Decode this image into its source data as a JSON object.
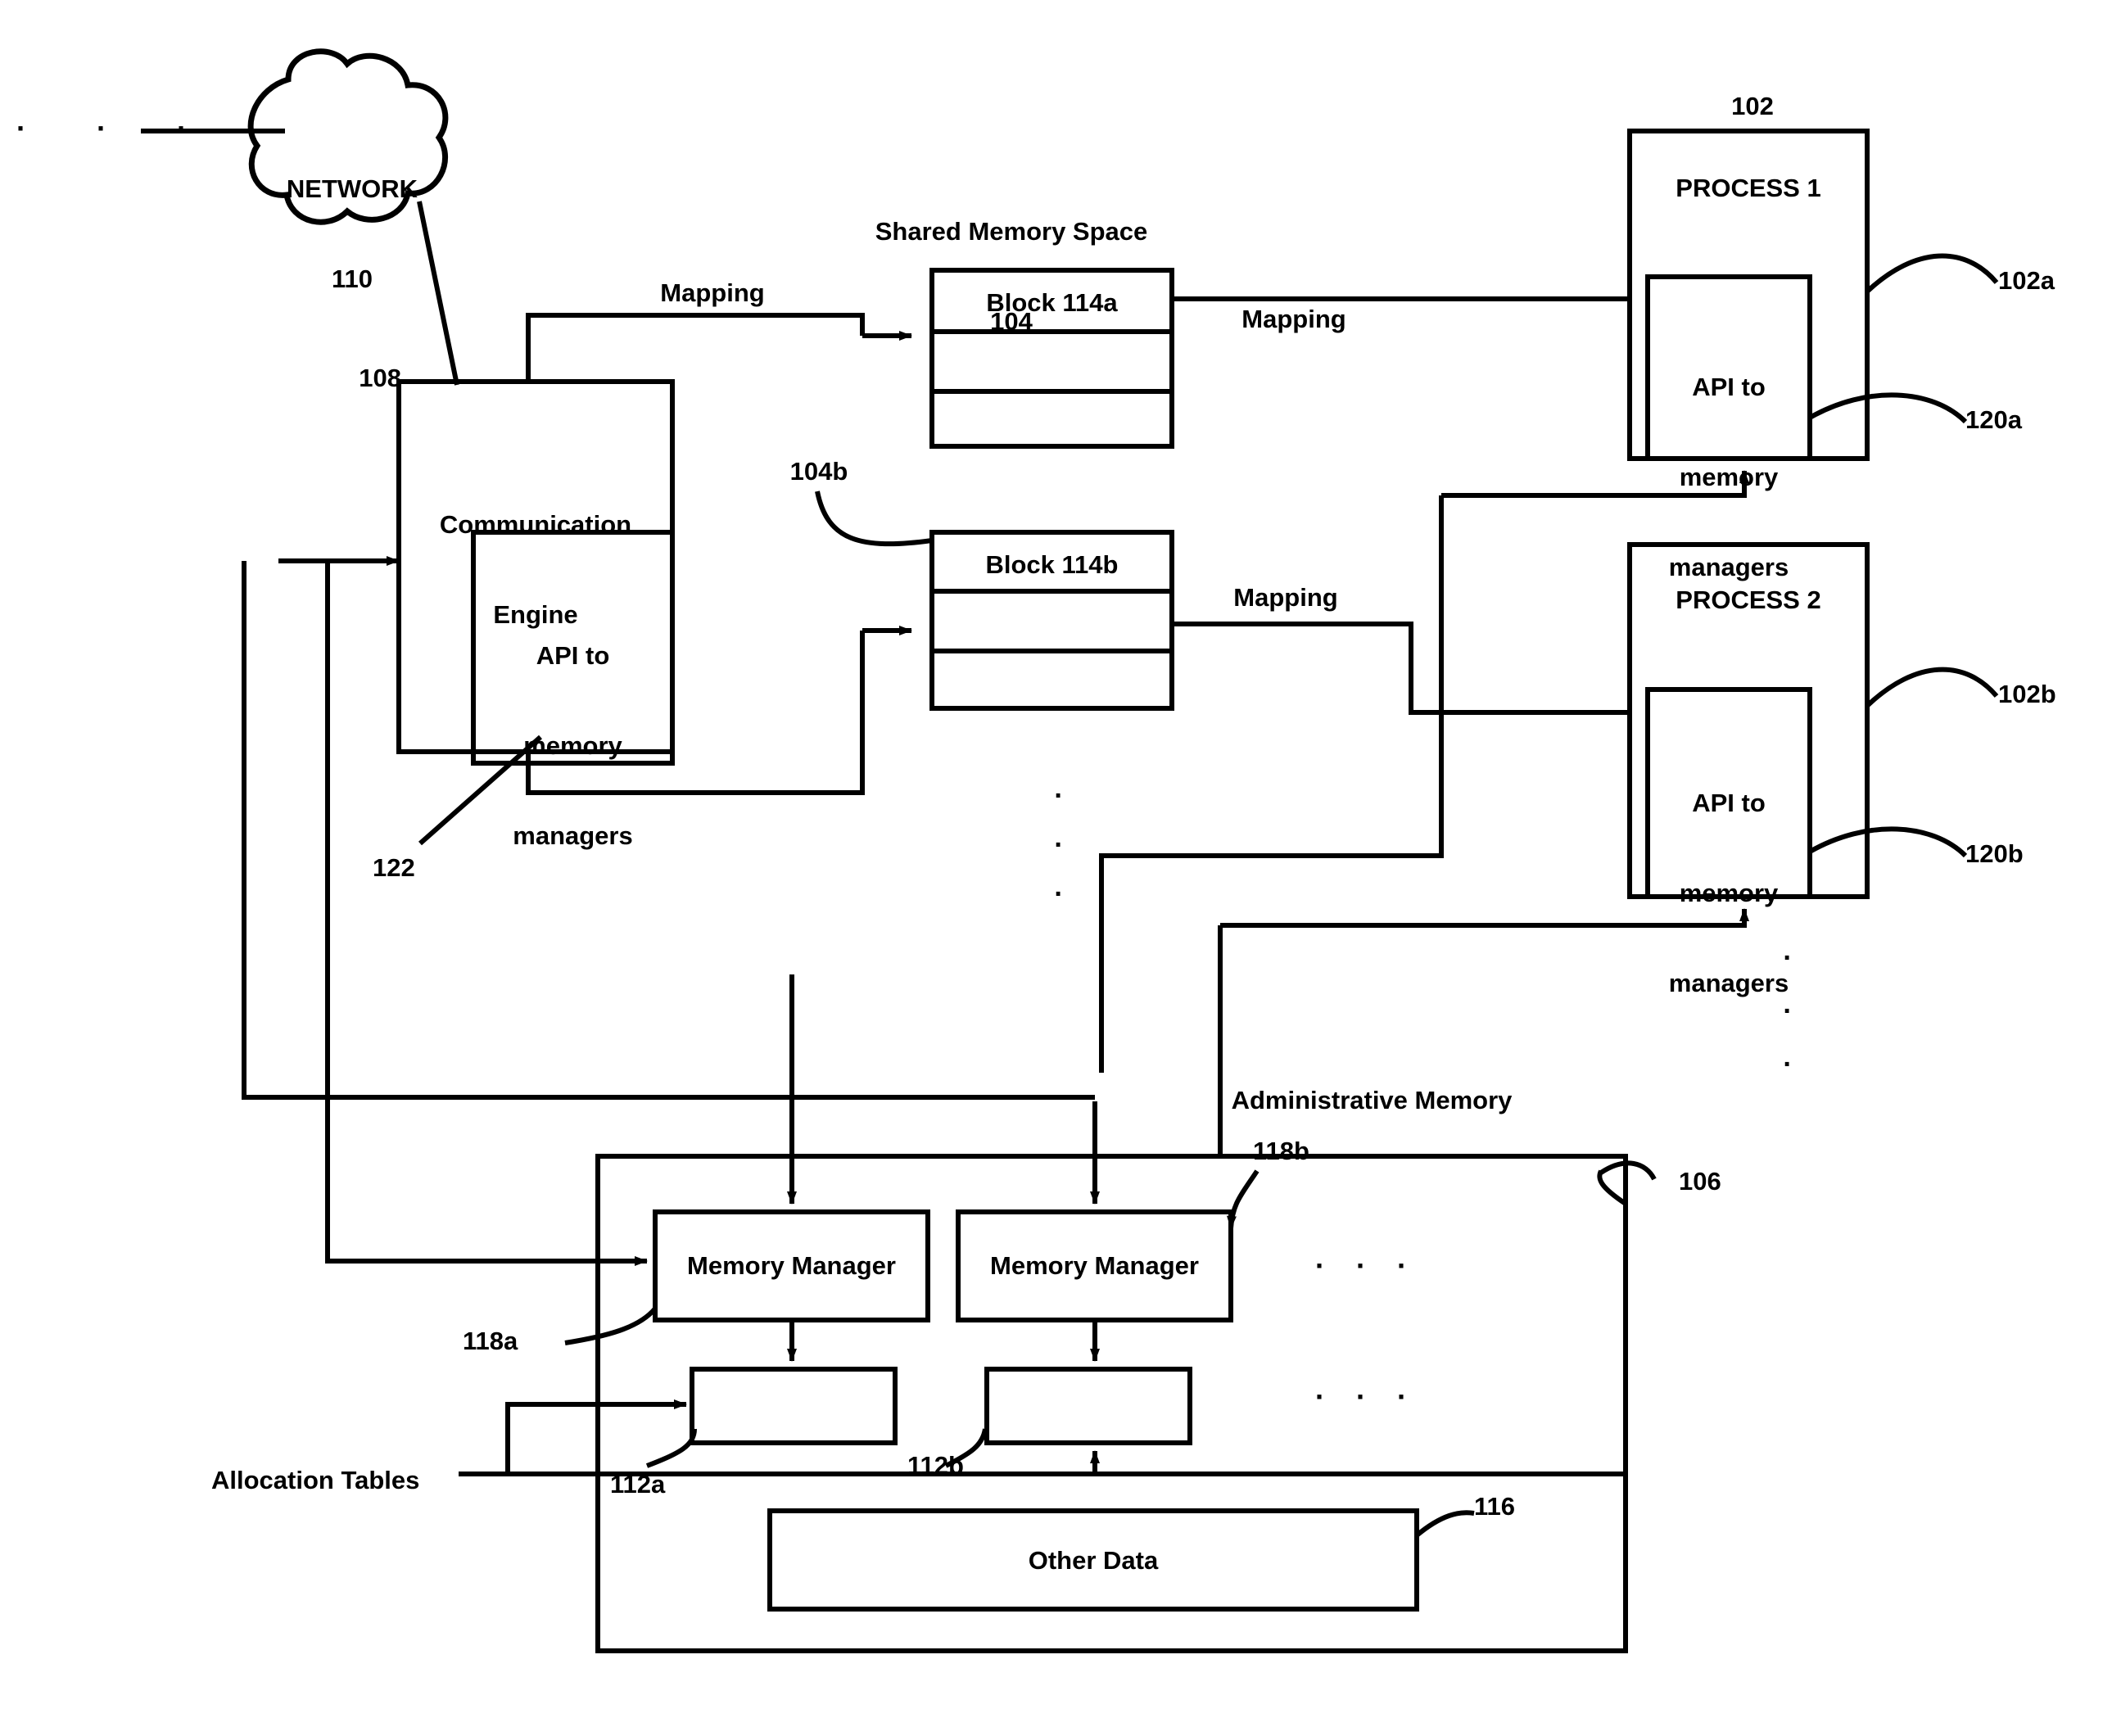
{
  "figure": {
    "type": "patent-block-diagram",
    "background": "#ffffff",
    "stroke": "#000000"
  },
  "network": {
    "label_line1": "NETWORK",
    "label_line2": "110"
  },
  "comm_engine": {
    "ref": "108",
    "title_line1": "Communication",
    "title_line2": "Engine",
    "api_line1": "API to",
    "api_line2": "memory",
    "api_line3": "managers",
    "api_ref": "122"
  },
  "shared_memory": {
    "title_line1": "Shared Memory Space",
    "title_line2": "104",
    "block_a_label": "Block 114a",
    "block_b_label": "Block 114b",
    "block_b_ref": "104b",
    "vertical_ellipsis": [
      "·",
      "·",
      "·"
    ]
  },
  "mapping_labels": {
    "mapping_1": "Mapping",
    "mapping_2": "Mapping",
    "mapping_3": "Mapping"
  },
  "processes": {
    "group_ref": "102",
    "items": [
      {
        "title": "PROCESS 1",
        "ref": "102a",
        "api_ref": "120a",
        "api_line1": "API to",
        "api_line2": "memory",
        "api_line3": "managers"
      },
      {
        "title": "PROCESS 2",
        "ref": "102b",
        "api_ref": "120b",
        "api_line1": "API to",
        "api_line2": "memory",
        "api_line3": "managers"
      }
    ],
    "vertical_ellipsis": [
      "·",
      "·",
      "·"
    ]
  },
  "admin_memory": {
    "title": "Administrative Memory",
    "ref": "106",
    "memory_managers": [
      {
        "label": "Memory Manager",
        "ref": "118a"
      },
      {
        "label": "Memory Manager",
        "ref": "118b"
      }
    ],
    "alloc_tables": [
      {
        "label": "",
        "ref": "112a"
      },
      {
        "label": "",
        "ref": "112b"
      }
    ],
    "alloc_tables_caption": "Allocation Tables",
    "other_data": {
      "label": "Other Data",
      "ref": "116"
    },
    "horizontal_ellipsis_1": "·  ·  ·",
    "horizontal_ellipsis_2": "·  ·  ·"
  },
  "left_dots": "·   ·   ·"
}
